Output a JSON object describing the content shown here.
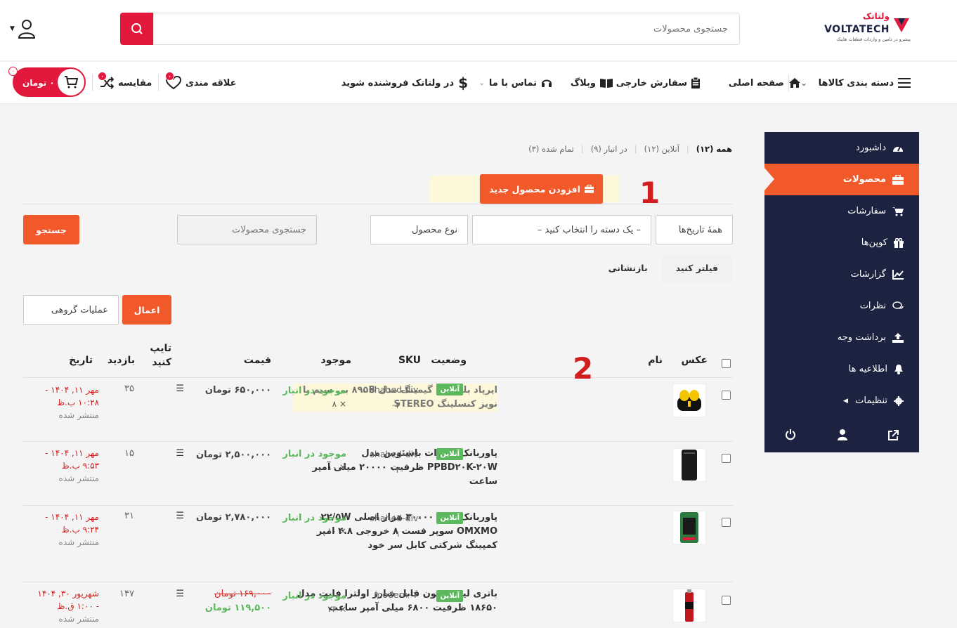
{
  "header": {
    "logo_fa": "ولتاتک",
    "logo_en": "VOLTATECH",
    "tagline": "پیشرو در تامین و واردات قطعات هایتک",
    "search_placeholder": "جستجوی محصولات"
  },
  "nav": {
    "categories": "دسته بندی کالاها",
    "home": "صفحه اصلی",
    "foreign": "سفارش خارجی",
    "blog": "وبلاگ",
    "contact": "تماس با ما",
    "seller": "در ولتاتک فروشنده شوید",
    "wishlist": "علاقه مندی",
    "wishlist_count": "۰",
    "compare": "مقایسه",
    "compare_count": "۰",
    "cart_price": "۰ تومان",
    "cart_count": "۰"
  },
  "sidebar": {
    "items": [
      {
        "label": "داشبورد",
        "icon": "dashboard-icon"
      },
      {
        "label": "محصولات",
        "icon": "briefcase-icon"
      },
      {
        "label": "سفارشات",
        "icon": "cart-icon"
      },
      {
        "label": "کوپن‌ها",
        "icon": "gift-icon"
      },
      {
        "label": "گزارشات",
        "icon": "chart-icon"
      },
      {
        "label": "نظرات",
        "icon": "comments-icon"
      },
      {
        "label": "برداشت وجه",
        "icon": "upload-icon"
      },
      {
        "label": "اطلاعیه ها",
        "icon": "bell-icon"
      },
      {
        "label": "تنظیمات",
        "icon": "gear-icon"
      }
    ]
  },
  "statuses": {
    "all": "همه (۱۲)",
    "online": "آنلاین (۱۲)",
    "stock": "در انبار (۹)",
    "done": "تمام شده (۳)"
  },
  "add_button": "افزودن محصول جدید",
  "annotations": {
    "one": "1",
    "two": "2"
  },
  "filters": {
    "dates": "همهٔ تاریخ‌ها",
    "category": "– یک دسته را انتخاب کنید –",
    "type": "نوع محصول",
    "search_placeholder": "جستجوی محصولات",
    "search_btn": "جستجو",
    "filter_tab": "فیلتر کنید",
    "reset_tab": "بازنشانی",
    "bulk": "عملیات گروهی",
    "apply": "اعمال"
  },
  "table": {
    "headers": {
      "image": "عکس",
      "name": "نام",
      "status": "وضعیت",
      "sku": "SKU",
      "stock": "موجود",
      "price": "قیمت",
      "type_l1": "تایپ",
      "type_l2": "کنید",
      "views": "بازدید",
      "date": "تاریخ"
    },
    "rows": [
      {
        "name": "ایرپاد بلوتوثی گیمینگ مدل ۸۹۵B بی سیم با نویز کنسلینگ STEREO",
        "status": "آنلاین",
        "sku_l1": "shahed-div-",
        "sku_l2": "۰۳",
        "stock": "موجود در انبار",
        "qty": "× ۸",
        "price": "۶۵۰,۰۰۰ تومان",
        "views": "۳۵",
        "date_l1": "مهر ۱۱, ۱۴۰۴ -",
        "date_l2": "۱۰:۲۸ ب.ظ",
        "published": "منتشر شده"
      },
      {
        "name": "پاوربانک ۲۰ وات باسئوس مدل PPBD۲۰K-۲۰W ظرفیت ۲۰۰۰۰ میلی آمپر ساعت",
        "status": "آنلاین",
        "sku_l1": "shahed-div-",
        "sku_l2": "۰۲",
        "stock": "موجود در انبار",
        "qty": "× ۱۰",
        "price": "۲,۵۰۰,۰۰۰ تومان",
        "views": "۱۵",
        "date_l1": "مهر ۱۱, ۱۴۰۴ -",
        "date_l2": "۹:۵۳ ب.ظ",
        "published": "منتشر شده"
      },
      {
        "name": "پاوربانک غول ۳۰۰۰۰ هزار اصلی ۲۲/۵W OMXMO سوپر فست ۸ خروجی ۴.۸ امپر کمپینگ شرکتی کابل سر خود",
        "status": "آنلاین",
        "sku_l1": "shahed-div-",
        "sku_l2": "۰۱",
        "stock": "موجود در انبار",
        "qty": "× ۱۰",
        "price": "۲,۷۸۰,۰۰۰ تومان",
        "views": "۳۱",
        "date_l1": "مهر ۱۱, ۱۴۰۴ -",
        "date_l2": "۹:۲۴ ب.ظ",
        "published": "منتشر شده"
      },
      {
        "name": "باتری لیتیوم یون قابل شارژ اولترا فایت مدل ۱۸۶۵۰ ظرفیت ۶۸۰۰ میلی آمپر ساعت",
        "status": "آنلاین",
        "sku_l1": "modern۰۱",
        "sku_l2": "",
        "stock": "موجود در انبار",
        "qty": "× ۲۶",
        "price_old": "۱۶۹,۰۰۰ تومان",
        "price": "۱۱۹,۵۰۰ تومان",
        "views": "۱۴۷",
        "date_l1": "شهریور ۳۰, ۱۴۰۴",
        "date_l2": "- ۱:۰۰ ق.ظ",
        "published": "منتشر شده"
      }
    ]
  }
}
